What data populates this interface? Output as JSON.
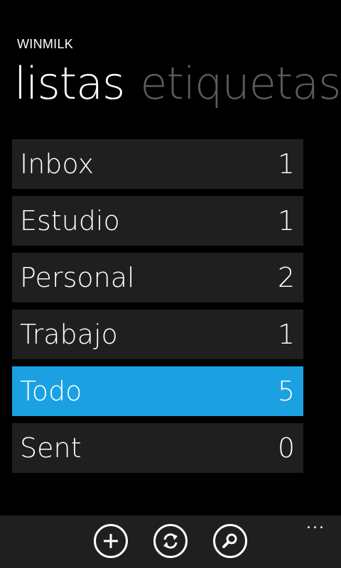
{
  "app": {
    "title": "WINMILK"
  },
  "pivot": {
    "items": [
      {
        "label": "listas",
        "active": true
      },
      {
        "label": "etiquetas",
        "active": false
      }
    ]
  },
  "lists": [
    {
      "name": "Inbox",
      "count": "1"
    },
    {
      "name": "Estudio",
      "count": "1"
    },
    {
      "name": "Personal",
      "count": "2"
    },
    {
      "name": "Trabajo",
      "count": "1"
    },
    {
      "name": "Todo",
      "count": "5",
      "selected": true
    },
    {
      "name": "Sent",
      "count": "0"
    }
  ],
  "appbar": {
    "buttons": [
      {
        "icon": "add-icon"
      },
      {
        "icon": "sync-icon"
      },
      {
        "icon": "search-icon"
      }
    ],
    "more_label": "..."
  },
  "colors": {
    "background": "#000000",
    "row_background": "#1f1f1f",
    "accent": "#1ba1e2",
    "inactive_pivot": "#5c5c5c",
    "appbar_background": "#1f1f1f"
  }
}
